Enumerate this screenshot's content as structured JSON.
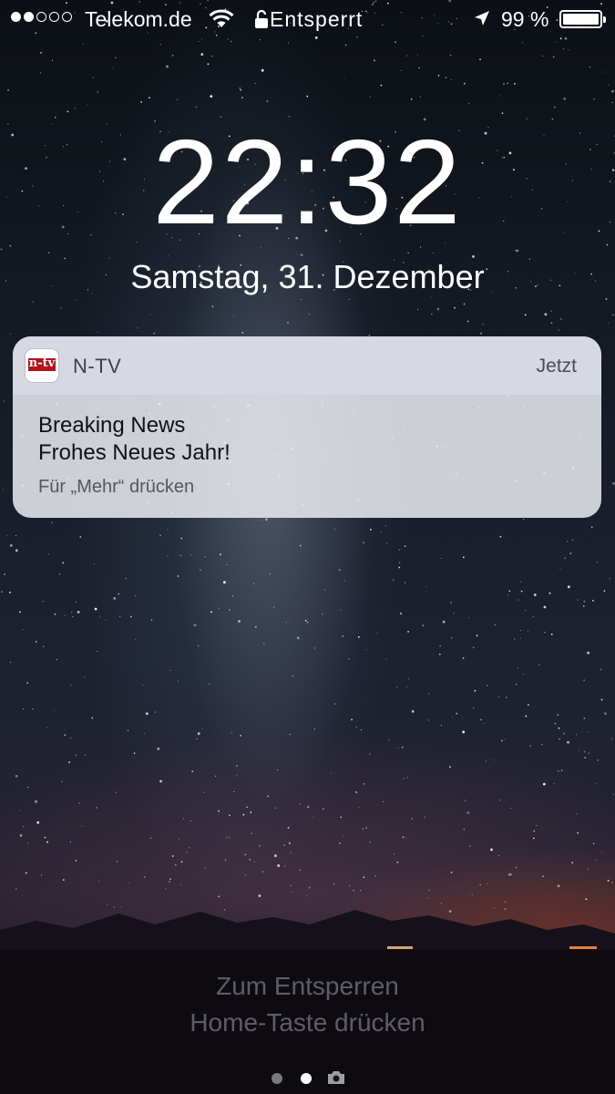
{
  "status_bar": {
    "carrier": "Telekom.de",
    "lock_label": "Entsperrt",
    "battery_percent": "99 %",
    "battery_level": 0.99,
    "signal_bars_filled": 2,
    "signal_bars_total": 5,
    "icons": [
      "wifi-icon",
      "lock-icon",
      "location-arrow-icon",
      "battery-icon"
    ]
  },
  "lockscreen": {
    "time": "22:32",
    "date": "Samstag, 31. Dezember"
  },
  "notification": {
    "app_name": "N-TV",
    "app_icon_text": "n-tv",
    "time": "Jetzt",
    "title": "Breaking News",
    "body": "Frohes Neues Jahr!",
    "hint": "Für „Mehr“ drücken"
  },
  "unlock": {
    "line1": "Zum Entsperren",
    "line2": "Home-Taste drücken"
  },
  "page_indicator": {
    "pages": 2,
    "current": 2,
    "extra_icon": "camera-icon"
  }
}
